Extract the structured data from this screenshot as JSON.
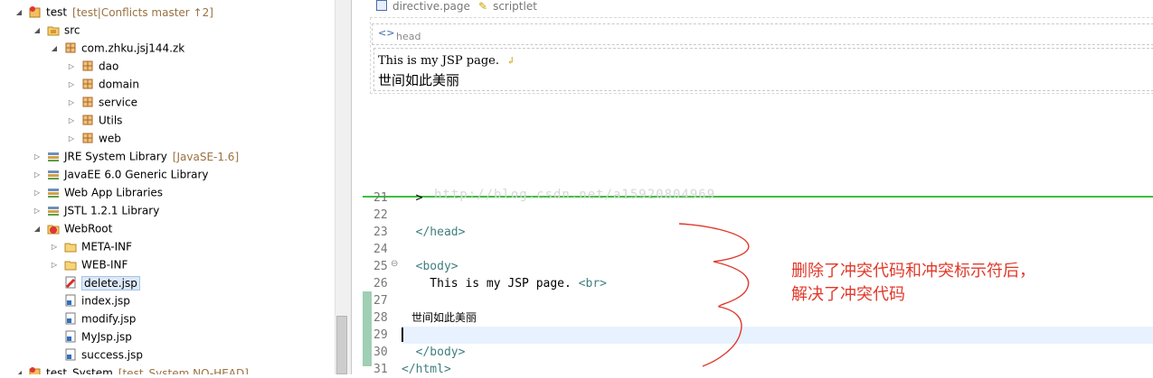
{
  "explorer": {
    "items": [
      {
        "label": "test",
        "decoration": "[test|Conflicts master ↑2]",
        "icon": "project-icon",
        "twisty": "expanded"
      },
      {
        "label": "src",
        "icon": "source-folder-icon",
        "twisty": "expanded"
      },
      {
        "label": "com.zhku.jsj144.zk",
        "icon": "package-icon",
        "twisty": "expanded"
      },
      {
        "label": "dao",
        "icon": "package-icon",
        "twisty": "collapsed"
      },
      {
        "label": "domain",
        "icon": "package-icon",
        "twisty": "collapsed"
      },
      {
        "label": "service",
        "icon": "package-icon",
        "twisty": "collapsed"
      },
      {
        "label": "Utils",
        "icon": "package-icon",
        "twisty": "collapsed"
      },
      {
        "label": "web",
        "icon": "package-icon",
        "twisty": "collapsed"
      },
      {
        "label": "JRE System Library",
        "decoration": "[JavaSE-1.6]",
        "icon": "library-icon",
        "twisty": "collapsed"
      },
      {
        "label": "JavaEE 6.0 Generic Library",
        "icon": "library-icon",
        "twisty": "collapsed"
      },
      {
        "label": "Web App Libraries",
        "icon": "library-icon",
        "twisty": "collapsed"
      },
      {
        "label": "JSTL 1.2.1 Library",
        "icon": "library-icon",
        "twisty": "collapsed"
      },
      {
        "label": "WebRoot",
        "icon": "webroot-icon",
        "twisty": "expanded"
      },
      {
        "label": "META-INF",
        "icon": "folder-icon",
        "twisty": "collapsed"
      },
      {
        "label": "WEB-INF",
        "icon": "folder-icon",
        "twisty": "collapsed"
      },
      {
        "label": "delete.jsp",
        "icon": "conflict-jsp-icon",
        "twisty": "none"
      },
      {
        "label": "index.jsp",
        "icon": "jsp-file-icon",
        "twisty": "none"
      },
      {
        "label": "modify.jsp",
        "icon": "jsp-file-icon",
        "twisty": "none"
      },
      {
        "label": "MyJsp.jsp",
        "icon": "jsp-file-icon",
        "twisty": "none"
      },
      {
        "label": "success.jsp",
        "icon": "jsp-file-icon",
        "twisty": "none"
      },
      {
        "label": "test_System",
        "decoration": "[test_System NO-HEAD]",
        "icon": "project-icon",
        "twisty": "expanded"
      }
    ]
  },
  "design": {
    "tab_directive": "directive.page",
    "tab_scriptlet": "scriptlet",
    "head_label": "head",
    "body_line1": "This is my JSP page.",
    "body_line2": "世间如此美丽"
  },
  "editor": {
    "lines": [
      {
        "num": "21",
        "text": "  >"
      },
      {
        "num": "22",
        "text": ""
      },
      {
        "num": "23",
        "text": "  </head>"
      },
      {
        "num": "24",
        "text": ""
      },
      {
        "num": "25",
        "text": "  <body>"
      },
      {
        "num": "26",
        "text": "    This is my JSP page. <br>"
      },
      {
        "num": "27",
        "text": ""
      },
      {
        "num": "28",
        "text": "世间如此美丽"
      },
      {
        "num": "29",
        "text": ""
      },
      {
        "num": "30",
        "text": "  </body>"
      },
      {
        "num": "31",
        "text": "</html>"
      }
    ],
    "watermark": "http://blog.csdn.net/a15920804969",
    "annotation_line1": "删除了冲突代码和冲突标示符后，",
    "annotation_line2": "解决了冲突代码"
  },
  "colors": {
    "tag": "#3f7f7f",
    "annotation": "#e0392b",
    "divider": "#3fbf3f",
    "selection": "#dde9f7"
  }
}
